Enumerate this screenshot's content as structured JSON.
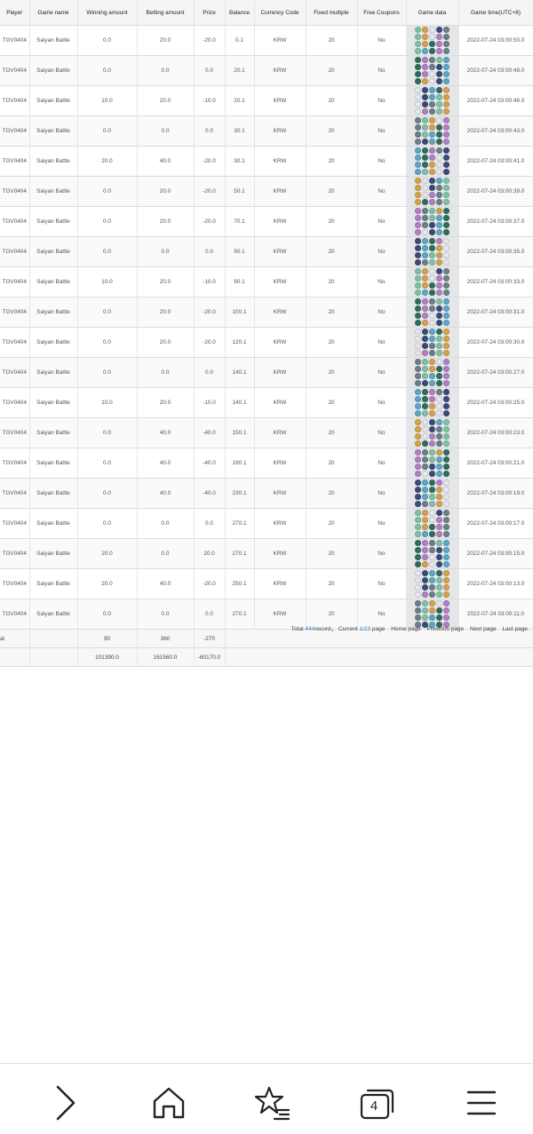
{
  "table": {
    "headers": [
      "Player",
      "Game name",
      "Winning amount",
      "Betting amount",
      "Prize",
      "Balance",
      "Currency Code",
      "Fixed multiple",
      "Free Coupons",
      "Game data",
      "Game time(UTC+8)"
    ],
    "rows": [
      [
        "TGV0404",
        "Saiyan Battle",
        "0.0",
        "20.0",
        "-20.0",
        "0.1",
        "KRW",
        "20",
        "No",
        "2022-07-24 03:00:50.0"
      ],
      [
        "TGV0404",
        "Saiyan Battle",
        "0.0",
        "0.0",
        "0.0",
        "20.1",
        "KRW",
        "20",
        "No",
        "2022-07-24 03:00:48.0"
      ],
      [
        "TGV0404",
        "Saiyan Battle",
        "10.0",
        "20.0",
        "-10.0",
        "20.1",
        "KRW",
        "20",
        "No",
        "2022-07-24 03:00:46.0"
      ],
      [
        "TGV0404",
        "Saiyan Battle",
        "0.0",
        "0.0",
        "0.0",
        "30.1",
        "KRW",
        "20",
        "No",
        "2022-07-24 03:00:43.0"
      ],
      [
        "TGV0404",
        "Saiyan Battle",
        "20.0",
        "40.0",
        "-20.0",
        "30.1",
        "KRW",
        "20",
        "No",
        "2022-07-24 03:00:41.0"
      ],
      [
        "TGV0404",
        "Saiyan Battle",
        "0.0",
        "20.0",
        "-20.0",
        "50.1",
        "KRW",
        "20",
        "No",
        "2022-07-24 03:00:39.0"
      ],
      [
        "TGV0404",
        "Saiyan Battle",
        "0.0",
        "20.0",
        "-20.0",
        "70.1",
        "KRW",
        "20",
        "No",
        "2022-07-24 03:00:37.0"
      ],
      [
        "TGV0404",
        "Saiyan Battle",
        "0.0",
        "0.0",
        "0.0",
        "90.1",
        "KRW",
        "20",
        "No",
        "2022-07-24 03:00:35.0"
      ],
      [
        "TGV0404",
        "Saiyan Battle",
        "10.0",
        "20.0",
        "-10.0",
        "90.1",
        "KRW",
        "20",
        "No",
        "2022-07-24 03:00:33.0"
      ],
      [
        "TGV0404",
        "Saiyan Battle",
        "0.0",
        "20.0",
        "-20.0",
        "100.1",
        "KRW",
        "20",
        "No",
        "2022-07-24 03:00:31.0"
      ],
      [
        "TGV0404",
        "Saiyan Battle",
        "0.0",
        "20.0",
        "-20.0",
        "120.1",
        "KRW",
        "20",
        "No",
        "2022-07-24 03:00:30.0"
      ],
      [
        "TGV0404",
        "Saiyan Battle",
        "0.0",
        "0.0",
        "0.0",
        "140.1",
        "KRW",
        "20",
        "No",
        "2022-07-24 03:00:27.0"
      ],
      [
        "TGV0404",
        "Saiyan Battle",
        "10.0",
        "20.0",
        "-10.0",
        "140.1",
        "KRW",
        "20",
        "No",
        "2022-07-24 03:00:25.0"
      ],
      [
        "TGV0404",
        "Saiyan Battle",
        "0.0",
        "40.0",
        "-40.0",
        "150.1",
        "KRW",
        "20",
        "No",
        "2022-07-24 03:00:23.0"
      ],
      [
        "TGV0404",
        "Saiyan Battle",
        "0.0",
        "40.0",
        "-40.0",
        "190.1",
        "KRW",
        "20",
        "No",
        "2022-07-24 03:00:21.0"
      ],
      [
        "TGV0404",
        "Saiyan Battle",
        "0.0",
        "40.0",
        "-40.0",
        "230.1",
        "KRW",
        "20",
        "No",
        "2022-07-24 03:00:19.0"
      ],
      [
        "TGV0404",
        "Saiyan Battle",
        "0.0",
        "0.0",
        "0.0",
        "270.1",
        "KRW",
        "20",
        "No",
        "2022-07-24 03:00:17.0"
      ],
      [
        "TGV0404",
        "Saiyan Battle",
        "20.0",
        "0.0",
        "20.0",
        "270.1",
        "KRW",
        "20",
        "No",
        "2022-07-24 03:00:15.0"
      ],
      [
        "TGV0404",
        "Saiyan Battle",
        "20.0",
        "40.0",
        "-20.0",
        "250.1",
        "KRW",
        "20",
        "No",
        "2022-07-24 03:00:13.0"
      ],
      [
        "TGV0404",
        "Saiyan Battle",
        "0.0",
        "0.0",
        "0.0",
        "270.1",
        "KRW",
        "20",
        "No",
        "2022-07-24 03:00:11.0"
      ]
    ],
    "subtotal": {
      "label": "al",
      "winning": "90",
      "betting": "360",
      "prize": "-270"
    },
    "grand_total": {
      "winning": "101390.0",
      "betting": "161560.0",
      "prize": "-60170.0"
    }
  },
  "game_data_symbol_colors": [
    "#7fc2a8",
    "#3a4a7a",
    "#b57ec7",
    "#d7a24a",
    "#5aa9c9",
    "#6b7f8c",
    "#e8e8f0",
    "#2f6d5f"
  ],
  "pagination": {
    "total_prefix": "Total ",
    "total_count": "444",
    "total_suffix": "record，",
    "current_prefix": "Current ",
    "current_page": "1/23",
    "current_suffix": " page",
    "home": "Home page",
    "previous": "Previous page",
    "next": "Next page",
    "last": "Last page"
  },
  "navbar": {
    "tab_count": "4"
  }
}
